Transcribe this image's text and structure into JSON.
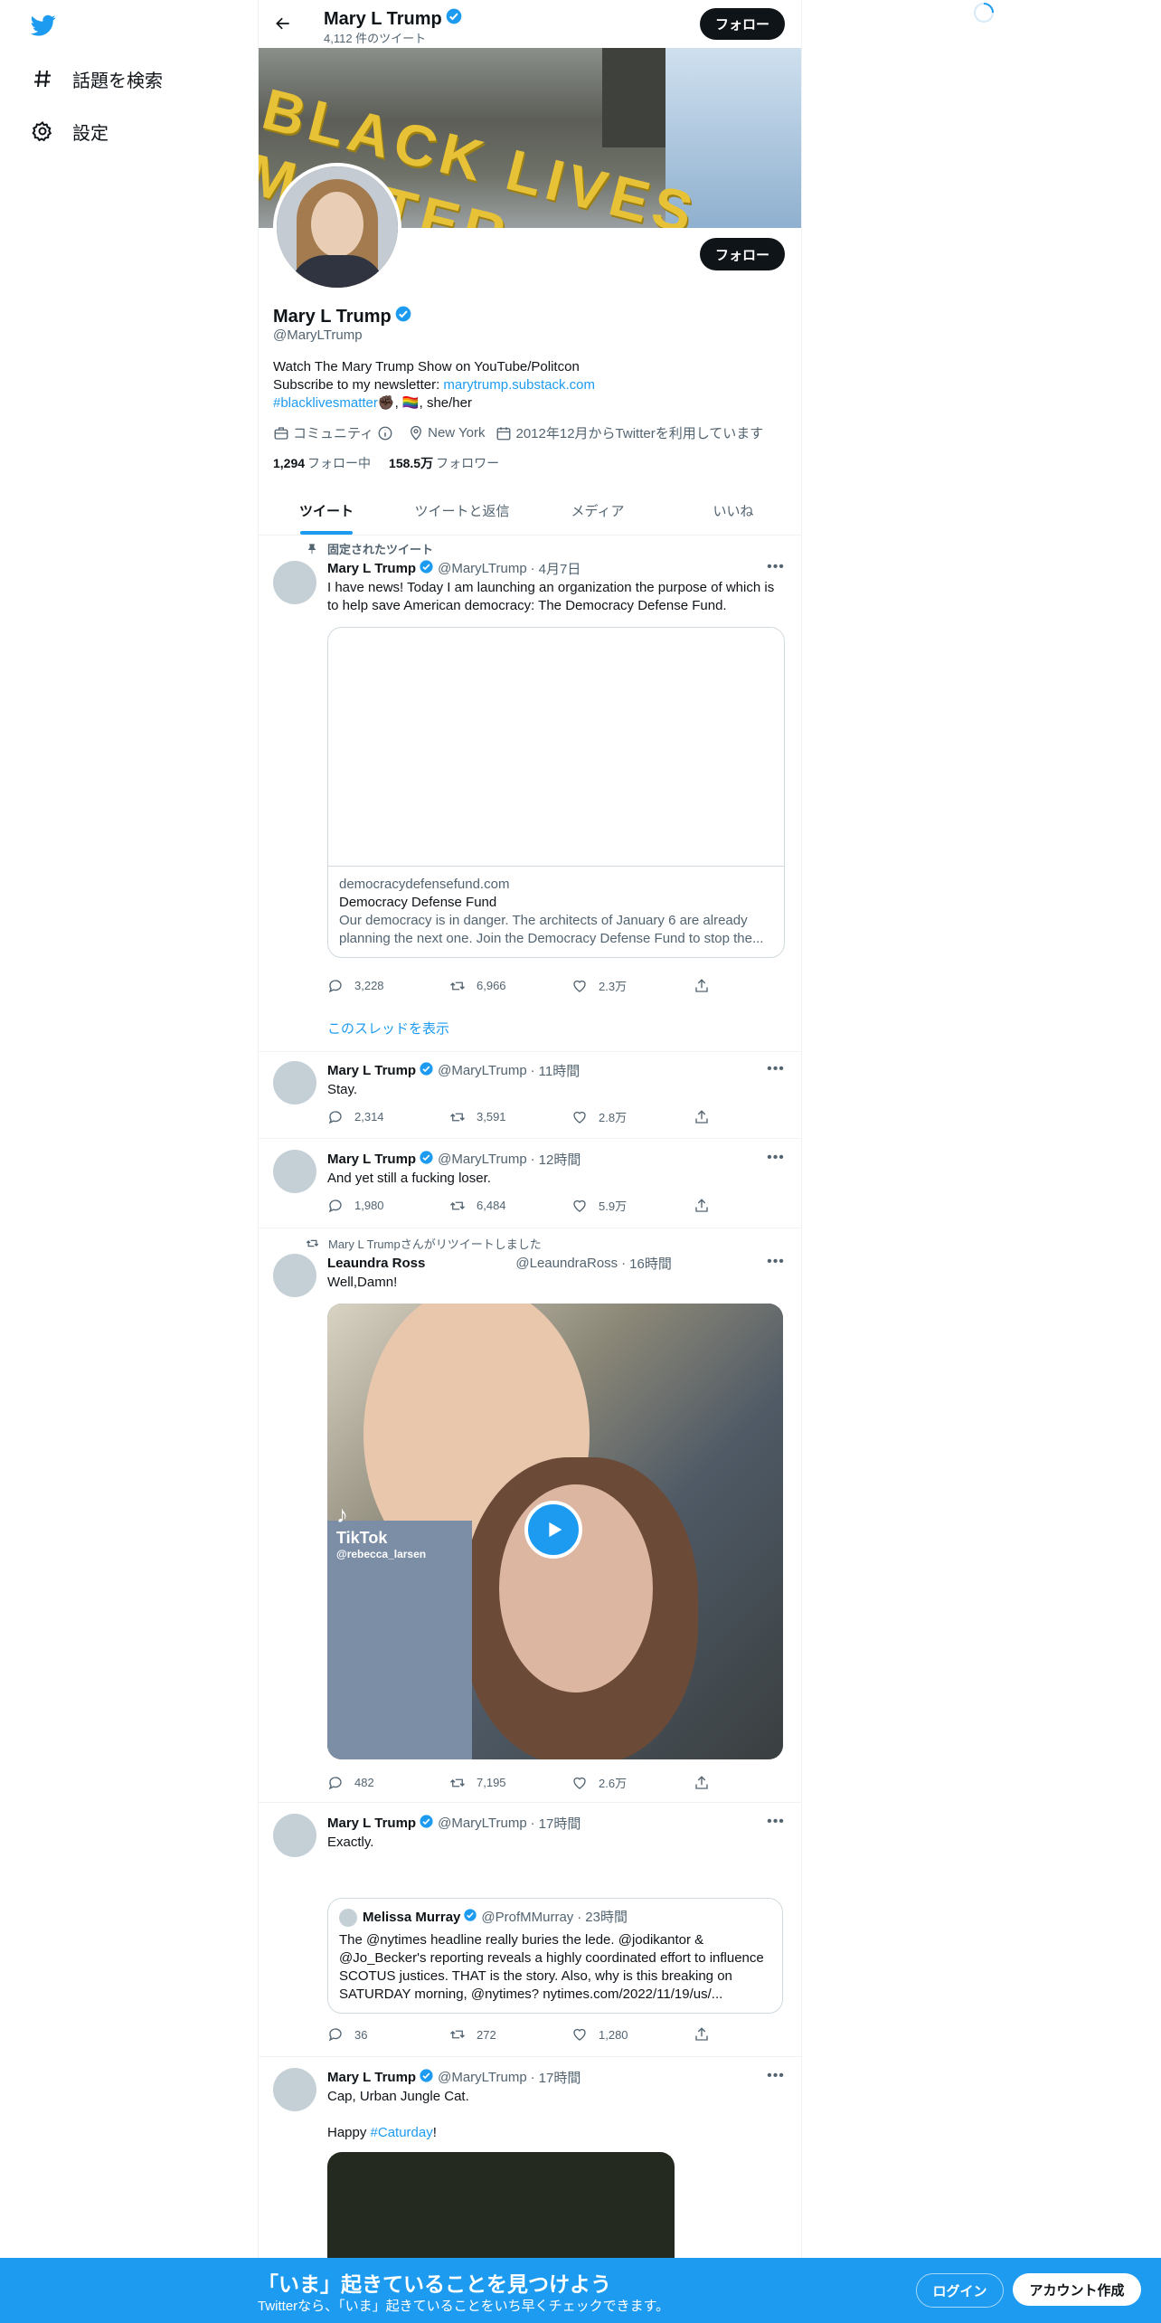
{
  "nav": {
    "explore": "話題を検索",
    "settings": "設定"
  },
  "header": {
    "name": "Mary L Trump",
    "tweet_count": "4,112 件のツイート",
    "follow": "フォロー"
  },
  "banner": {
    "text": "BLACK LIVES MATTER"
  },
  "profile": {
    "name": "Mary L Trump",
    "handle": "@MaryLTrump",
    "follow": "フォロー",
    "bio_line1": "Watch The Mary Trump Show on YouTube/Politcon",
    "bio_line2_prefix": "Subscribe to my newsletter: ",
    "bio_link": "marytrump.substack.com",
    "bio_hashtag": "#blacklivesmatter",
    "bio_emoji1": "✊🏿",
    "bio_sep": ", ",
    "bio_emoji2": "🏳️‍🌈",
    "bio_pronouns": ", she/her",
    "category": "コミュニティ",
    "location": "New York",
    "joined": "2012年12月からTwitterを利用しています",
    "following_count": "1,294",
    "following_label": "フォロー中",
    "followers_count": "158.5万",
    "followers_label": "フォロワー"
  },
  "tabs": [
    "ツイート",
    "ツイートと返信",
    "メディア",
    "いいね"
  ],
  "tweets": [
    {
      "context": "固定されたツイート",
      "name": "Mary L Trump",
      "handle": "@MaryLTrump",
      "dot": "·",
      "time": "4月7日",
      "text": "I have news! Today I am launching an organization the purpose of which is to help save American democracy: The Democracy Defense Fund.",
      "card": {
        "domain": "democracydefensefund.com",
        "title": "Democracy Defense Fund",
        "desc": "Our democracy is in danger. The architects of January 6 are already planning the next one. Join the Democracy Defense Fund to stop the..."
      },
      "replies": "3,228",
      "retweets": "6,966",
      "likes": "2.3万",
      "thread": "このスレッドを表示"
    },
    {
      "name": "Mary L Trump",
      "handle": "@MaryLTrump",
      "dot": "·",
      "time": "11時間",
      "text": "Stay.",
      "replies": "2,314",
      "retweets": "3,591",
      "likes": "2.8万"
    },
    {
      "name": "Mary L Trump",
      "handle": "@MaryLTrump",
      "dot": "·",
      "time": "12時間",
      "text": "And yet still a fucking loser.",
      "replies": "1,980",
      "retweets": "6,484",
      "likes": "5.9万"
    },
    {
      "context": "Mary L Trumpさんがリツイートしました",
      "name": "Leaundra Ross",
      "handle": "@LeaundraRoss",
      "dot": "·",
      "time": "16時間",
      "text": "Well,Damn!",
      "video": {
        "brand": "TikTok",
        "user": "@rebecca_larsen"
      },
      "replies": "482",
      "retweets": "7,195",
      "likes": "2.6万"
    },
    {
      "name": "Mary L Trump",
      "handle": "@MaryLTrump",
      "dot": "·",
      "time": "17時間",
      "text": "Exactly.",
      "quote": {
        "name": "Melissa Murray",
        "handle": "@ProfMMurray",
        "dot": "·",
        "time": "23時間",
        "text": "The @nytimes headline really buries the lede. @jodikantor & @Jo_Becker's reporting reveals a highly coordinated effort to influence SCOTUS justices. THAT is the story. Also, why is this breaking on SATURDAY morning, @nytimes? nytimes.com/2022/11/19/us/..."
      },
      "replies": "36",
      "retweets": "272",
      "likes": "1,280"
    },
    {
      "name": "Mary L Trump",
      "handle": "@MaryLTrump",
      "dot": "·",
      "time": "17時間",
      "text": "Cap, Urban Jungle Cat.",
      "text2_prefix": "Happy ",
      "text2_hashtag": "#Caturday",
      "text2_suffix": "!"
    }
  ],
  "bottom_bar": {
    "title": "「いま」起きていることを見つけよう",
    "subtitle": "Twitterなら、「いま」起きていることをいち早くチェックできます。",
    "login": "ログイン",
    "signup": "アカウント作成"
  },
  "colors": {
    "accent": "#1d9bf0",
    "text": "#0f1419",
    "secondary": "#536471"
  }
}
